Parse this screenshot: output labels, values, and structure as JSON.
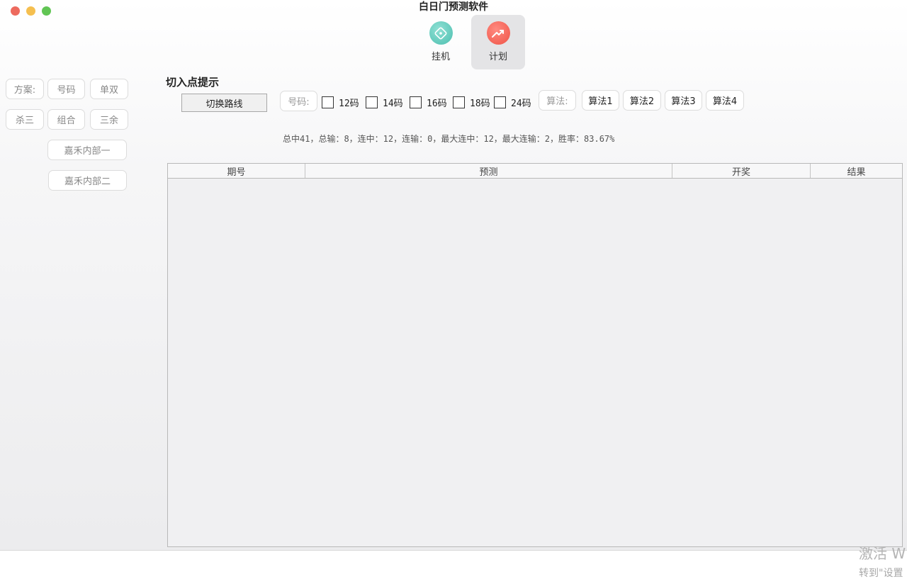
{
  "window": {
    "title": "白日门预测软件"
  },
  "toolbar": {
    "items": [
      {
        "label": "挂机",
        "icon": "compass-icon",
        "active": false
      },
      {
        "label": "计划",
        "icon": "trend-chart-icon",
        "active": true
      }
    ]
  },
  "sidebar": {
    "scheme_label": "方案:",
    "buttons": [
      "号码",
      "单双",
      "杀三",
      "组合",
      "三余",
      "嘉禾内部一",
      "嘉禾内部二"
    ]
  },
  "main": {
    "section_title": "切入点提示",
    "switch_route_label": "切换路线",
    "number_label": "号码:",
    "checkboxes": [
      {
        "label": "12码",
        "checked": false
      },
      {
        "label": "14码",
        "checked": false
      },
      {
        "label": "16码",
        "checked": false
      },
      {
        "label": "18码",
        "checked": false
      },
      {
        "label": "24码",
        "checked": false
      }
    ],
    "algo_label": "算法:",
    "algorithms": [
      "算法1",
      "算法2",
      "算法3",
      "算法4"
    ],
    "stats": "总中41，总输：8，连中：12，连输：0，最大连中：12，最大连输：2，胜率：83.67%"
  },
  "table": {
    "columns": [
      "期号",
      "预测",
      "开奖",
      "结果"
    ],
    "rows": []
  },
  "watermark": {
    "line1": "激活 W",
    "line2": "转到\"设置"
  }
}
